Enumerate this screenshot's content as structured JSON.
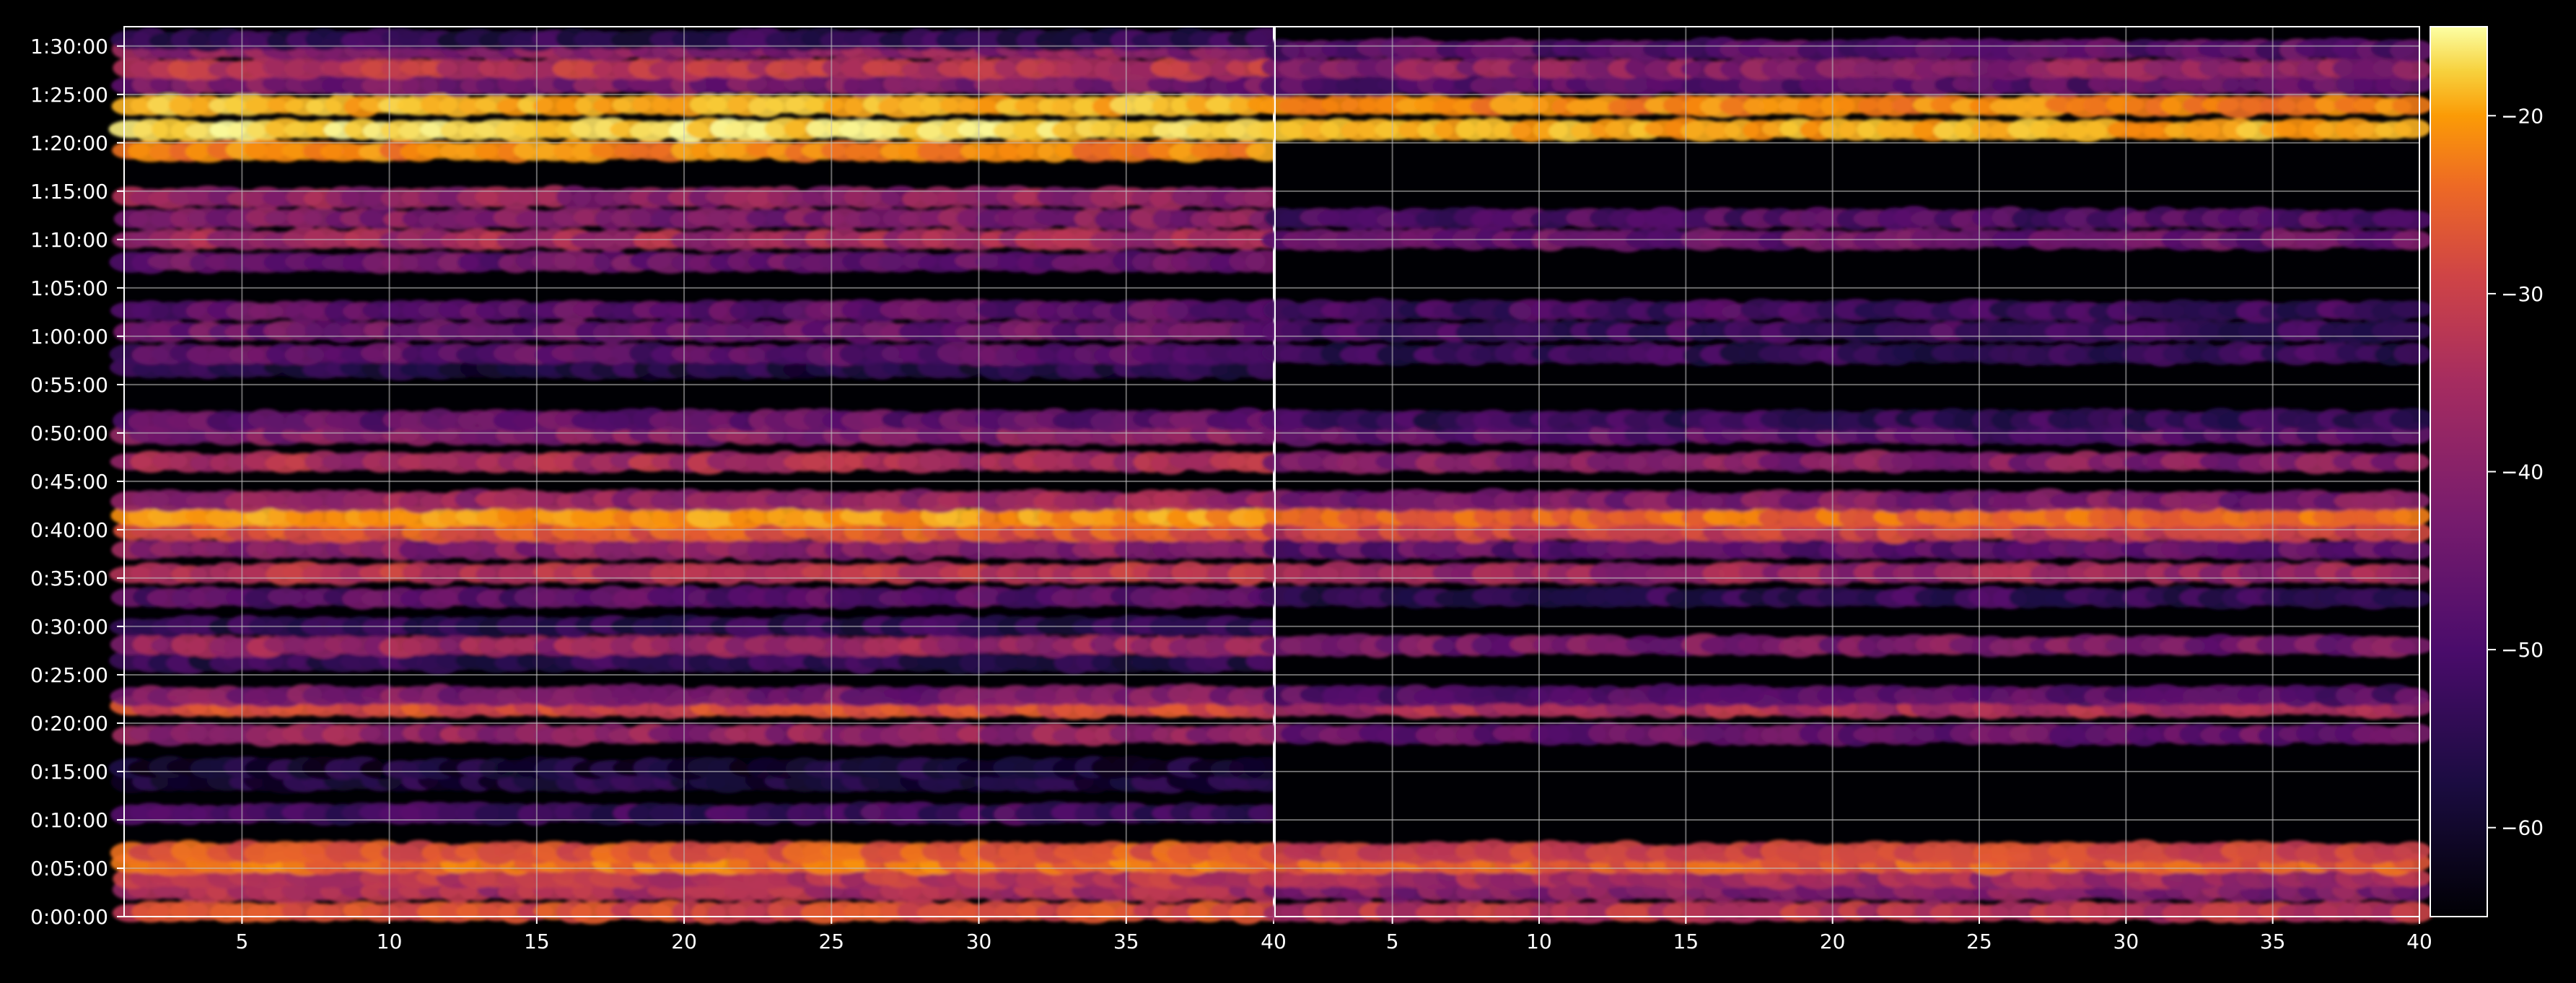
{
  "chart_data": {
    "type": "heatmap",
    "title": "",
    "xlabel": "",
    "ylabel": "",
    "colormap": "inferno",
    "background": "#000000",
    "grid": true,
    "grid_color": "#bfbfbf",
    "y_ticks": [
      "0:00:00",
      "0:05:00",
      "0:10:00",
      "0:15:00",
      "0:20:00",
      "0:25:00",
      "0:30:00",
      "0:35:00",
      "0:40:00",
      "0:45:00",
      "0:50:00",
      "0:55:00",
      "1:00:00",
      "1:05:00",
      "1:10:00",
      "1:15:00",
      "1:20:00",
      "1:25:00",
      "1:30:00"
    ],
    "ylim_seconds": [
      0,
      5520
    ],
    "colorbar": {
      "min": -65,
      "max": -15,
      "ticks": [
        -20,
        -30,
        -40,
        -50,
        -60
      ]
    },
    "panels": [
      {
        "name": "left",
        "xlim": [
          1,
          40
        ],
        "x_ticks": [
          5,
          10,
          15,
          20,
          25,
          30,
          35,
          40
        ],
        "bands": [
          {
            "t": 30,
            "db": -36,
            "h": 20
          },
          {
            "t": 160,
            "db": -42,
            "h": 20
          },
          {
            "t": 240,
            "db": -40,
            "h": 20
          },
          {
            "t": 330,
            "db": -30,
            "h": 20
          },
          {
            "t": 400,
            "db": -34,
            "h": 20
          },
          {
            "t": 640,
            "db": -55,
            "h": 20
          },
          {
            "t": 840,
            "db": -59,
            "h": 20
          },
          {
            "t": 920,
            "db": -60,
            "h": 20
          },
          {
            "t": 1130,
            "db": -45,
            "h": 20
          },
          {
            "t": 1300,
            "db": -36,
            "h": 20
          },
          {
            "t": 1370,
            "db": -48,
            "h": 20
          },
          {
            "t": 1580,
            "db": -57,
            "h": 20
          },
          {
            "t": 1680,
            "db": -44,
            "h": 20
          },
          {
            "t": 1800,
            "db": -57,
            "h": 20
          },
          {
            "t": 1980,
            "db": -52,
            "h": 20
          },
          {
            "t": 2130,
            "db": -40,
            "h": 20
          },
          {
            "t": 2280,
            "db": -46,
            "h": 20
          },
          {
            "t": 2390,
            "db": -34,
            "h": 20
          },
          {
            "t": 2480,
            "db": -26,
            "h": 20
          },
          {
            "t": 2580,
            "db": -44,
            "h": 20
          },
          {
            "t": 2820,
            "db": -42,
            "h": 20
          },
          {
            "t": 2990,
            "db": -47,
            "h": 20
          },
          {
            "t": 3080,
            "db": -51,
            "h": 20
          },
          {
            "t": 3400,
            "db": -58,
            "h": 20
          },
          {
            "t": 3490,
            "db": -52,
            "h": 20
          },
          {
            "t": 3630,
            "db": -50,
            "h": 20
          },
          {
            "t": 3760,
            "db": -51,
            "h": 20
          },
          {
            "t": 4060,
            "db": -50,
            "h": 20
          },
          {
            "t": 4200,
            "db": -43,
            "h": 20
          },
          {
            "t": 4330,
            "db": -47,
            "h": 20
          },
          {
            "t": 4460,
            "db": -45,
            "h": 20
          },
          {
            "t": 4750,
            "db": -28,
            "h": 20
          },
          {
            "t": 4880,
            "db": -19,
            "h": 20
          },
          {
            "t": 5030,
            "db": -23,
            "h": 20
          },
          {
            "t": 5160,
            "db": -48,
            "h": 20
          },
          {
            "t": 5260,
            "db": -40,
            "h": 20
          },
          {
            "t": 5380,
            "db": -46,
            "h": 20
          },
          {
            "t": 5440,
            "db": -57,
            "h": 20
          }
        ]
      },
      {
        "name": "right",
        "xlim": [
          1,
          40
        ],
        "x_ticks": [
          5,
          10,
          15,
          20,
          25,
          30,
          35,
          40
        ],
        "bands": [
          {
            "t": 30,
            "db": -40,
            "h": 20
          },
          {
            "t": 160,
            "db": -47,
            "h": 20
          },
          {
            "t": 240,
            "db": -43,
            "h": 20
          },
          {
            "t": 330,
            "db": -33,
            "h": 20
          },
          {
            "t": 400,
            "db": -37,
            "h": 20
          },
          {
            "t": 1130,
            "db": -50,
            "h": 20
          },
          {
            "t": 1300,
            "db": -42,
            "h": 20
          },
          {
            "t": 1370,
            "db": -52,
            "h": 20
          },
          {
            "t": 1680,
            "db": -48,
            "h": 20
          },
          {
            "t": 1980,
            "db": -56,
            "h": 20
          },
          {
            "t": 2130,
            "db": -44,
            "h": 20
          },
          {
            "t": 2280,
            "db": -51,
            "h": 20
          },
          {
            "t": 2390,
            "db": -38,
            "h": 20
          },
          {
            "t": 2480,
            "db": -31,
            "h": 20
          },
          {
            "t": 2580,
            "db": -48,
            "h": 20
          },
          {
            "t": 2820,
            "db": -47,
            "h": 20
          },
          {
            "t": 2990,
            "db": -52,
            "h": 20
          },
          {
            "t": 3080,
            "db": -56,
            "h": 20
          },
          {
            "t": 3490,
            "db": -56,
            "h": 20
          },
          {
            "t": 3630,
            "db": -55,
            "h": 20
          },
          {
            "t": 3760,
            "db": -55,
            "h": 20
          },
          {
            "t": 4200,
            "db": -50,
            "h": 20
          },
          {
            "t": 4330,
            "db": -53,
            "h": 20
          },
          {
            "t": 4880,
            "db": -24,
            "h": 20
          },
          {
            "t": 5030,
            "db": -28,
            "h": 20
          },
          {
            "t": 5160,
            "db": -52,
            "h": 20
          },
          {
            "t": 5260,
            "db": -46,
            "h": 20
          },
          {
            "t": 5380,
            "db": -52,
            "h": 20
          }
        ]
      }
    ]
  }
}
